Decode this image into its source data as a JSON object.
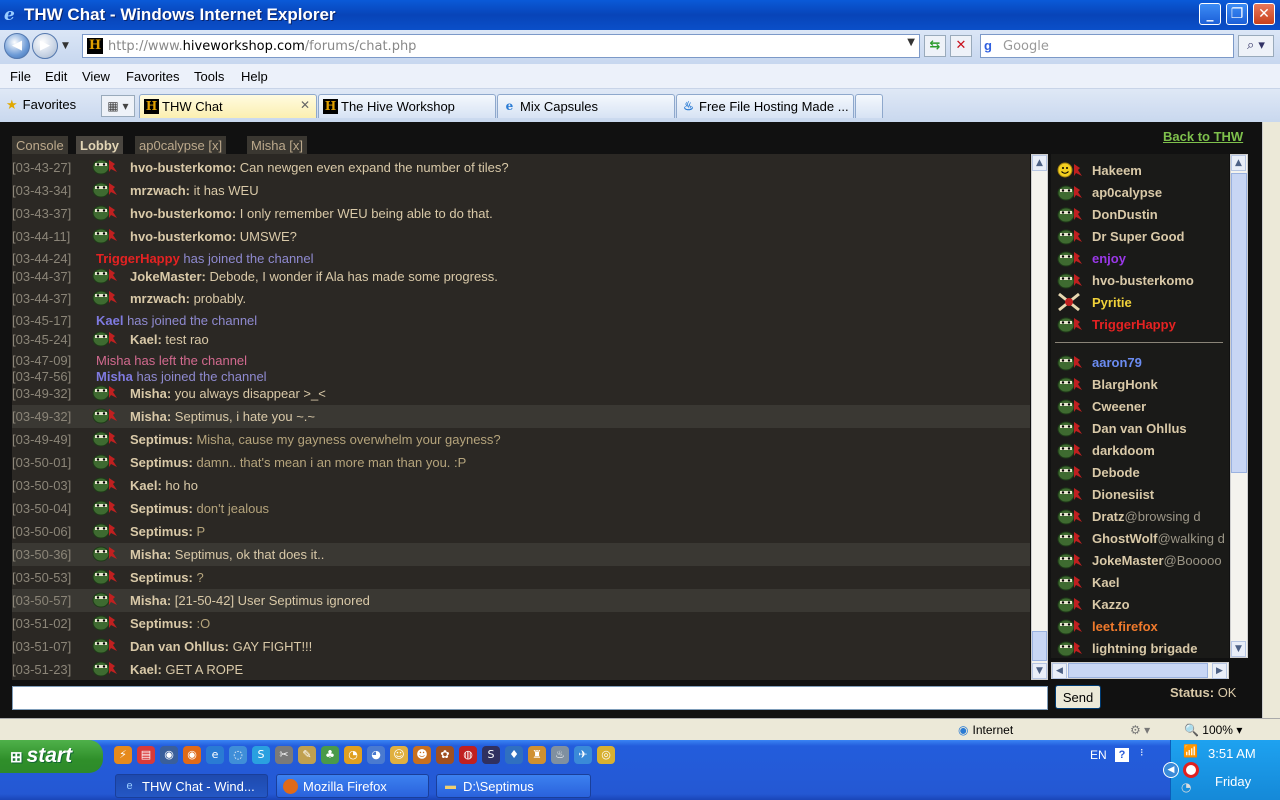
{
  "window": {
    "title": "THW Chat - Windows Internet Explorer",
    "url_prefix": "http://www.",
    "url_domain": "hiveworkshop.com",
    "url_path": "/forums/chat.php",
    "search_placeholder": "Google"
  },
  "menu": [
    "File",
    "Edit",
    "View",
    "Favorites",
    "Tools",
    "Help"
  ],
  "favorites_label": "Favorites",
  "browser_tabs": [
    {
      "label": "THW Chat",
      "active": true
    },
    {
      "label": "The Hive Workshop",
      "active": false
    },
    {
      "label": "Mix Capsules",
      "active": false
    },
    {
      "label": "Free File Hosting Made ...",
      "active": false
    }
  ],
  "chat": {
    "back_link": "Back to THW",
    "tabs": [
      "Console",
      "Lobby",
      "ap0calypse [x]",
      "Misha [x]"
    ],
    "active_tab": "Lobby",
    "messages": [
      {
        "time": "[03-43-27]",
        "nick": "hvo-busterkomo:",
        "text": "Can newgen even expand the number of tiles?",
        "type": "msg"
      },
      {
        "time": "[03-43-34]",
        "nick": "mrzwach:",
        "text": "it has WEU",
        "type": "msg"
      },
      {
        "time": "[03-43-37]",
        "nick": "hvo-busterkomo:",
        "text": "I only remember WEU being able to do that.",
        "type": "msg"
      },
      {
        "time": "[03-44-11]",
        "nick": "hvo-busterkomo:",
        "text": "UMSWE?",
        "type": "msg"
      },
      {
        "time": "[03-44-24]",
        "nick": "TriggerHappy",
        "text": "has joined the channel",
        "type": "join",
        "color": "#e52222"
      },
      {
        "time": "[03-44-37]",
        "nick": "JokeMaster:",
        "text": "Debode, I wonder if Ala has made some progress.",
        "type": "msg"
      },
      {
        "time": "[03-44-37]",
        "nick": "mrzwach:",
        "text": "probably.",
        "type": "msg"
      },
      {
        "time": "[03-45-17]",
        "nick": "Kael",
        "text": "has joined the channel",
        "type": "join",
        "color": "#7f7ae0"
      },
      {
        "time": "[03-45-24]",
        "nick": "Kael:",
        "text": "test rao",
        "type": "msg"
      },
      {
        "time": "[03-47-09]",
        "nick": "Misha has left the channel",
        "text": "",
        "type": "leave",
        "color": "#d26a8f"
      },
      {
        "time": "[03-47-56]",
        "nick": "Misha",
        "text": "has joined the channel",
        "type": "join",
        "color": "#7f7ae0"
      },
      {
        "time": "[03-49-32]",
        "nick": "Misha:",
        "text": "you always disappear >_<",
        "type": "msg"
      },
      {
        "time": "[03-49-32]",
        "nick": "Misha:",
        "text": "Septimus, i hate you ~.~",
        "type": "msg",
        "hl": true
      },
      {
        "time": "[03-49-49]",
        "nick": "Septimus:",
        "text": "Misha, cause my gayness overwhelm your gayness?",
        "type": "msg",
        "txtcolor": "#b5a47c"
      },
      {
        "time": "[03-50-01]",
        "nick": "Septimus:",
        "text": "damn.. that's mean i an more man than you. :P",
        "type": "msg",
        "txtcolor": "#b5a47c"
      },
      {
        "time": "[03-50-03]",
        "nick": "Kael:",
        "text": "ho ho",
        "type": "msg"
      },
      {
        "time": "[03-50-04]",
        "nick": "Septimus:",
        "text": "don't jealous",
        "type": "msg",
        "txtcolor": "#b5a47c"
      },
      {
        "time": "[03-50-06]",
        "nick": "Septimus:",
        "text": "P",
        "type": "msg",
        "txtcolor": "#b5a47c"
      },
      {
        "time": "[03-50-36]",
        "nick": "Misha:",
        "text": "Septimus, ok that does it..",
        "type": "msg",
        "hl": true
      },
      {
        "time": "[03-50-53]",
        "nick": "Septimus:",
        "text": "?",
        "type": "msg",
        "txtcolor": "#b5a47c"
      },
      {
        "time": "[03-50-57]",
        "nick": "Misha:",
        "text": "[21-50-42] User Septimus ignored",
        "type": "msg",
        "hl": true
      },
      {
        "time": "[03-51-02]",
        "nick": "Septimus:",
        "text": ":O",
        "type": "msg",
        "txtcolor": "#b5a47c"
      },
      {
        "time": "[03-51-07]",
        "nick": "Dan van Ohllus:",
        "text": "GAY FIGHT!!!",
        "type": "msg"
      },
      {
        "time": "[03-51-23]",
        "nick": "Kael:",
        "text": "GET A ROPE",
        "type": "msg"
      }
    ],
    "input_value": "",
    "send_label": "Send",
    "status_label": "Status:",
    "status_value": "OK"
  },
  "users": [
    {
      "name": "Hakeem",
      "color": "#d9c9a8",
      "icon": "smiley"
    },
    {
      "name": "ap0calypse",
      "color": "#d9c9a8"
    },
    {
      "name": "DonDustin",
      "color": "#d9c9a8"
    },
    {
      "name": "Dr Super Good",
      "color": "#d9c9a8"
    },
    {
      "name": "enjoy",
      "color": "#9a38e8"
    },
    {
      "name": "hvo-busterkomo",
      "color": "#d9c9a8"
    },
    {
      "name": "Pyritie",
      "color": "#f1d23a",
      "icon": "crossed-swords"
    },
    {
      "name": "TriggerHappy",
      "color": "#e52222"
    },
    {
      "name": "aaron79",
      "color": "#6b8cf2",
      "group2": true
    },
    {
      "name": "BlargHonk",
      "color": "#d9c9a8"
    },
    {
      "name": "Cweener",
      "color": "#d9c9a8"
    },
    {
      "name": "Dan van Ohllus",
      "color": "#d9c9a8"
    },
    {
      "name": "darkdoom",
      "color": "#d9c9a8"
    },
    {
      "name": "Debode",
      "color": "#d9c9a8"
    },
    {
      "name": "Dionesiist",
      "color": "#d9c9a8"
    },
    {
      "name": "Dratz",
      "status": "@browsing d",
      "color": "#d9c9a8"
    },
    {
      "name": "GhostWolf",
      "status": "@walking d",
      "color": "#d9c9a8"
    },
    {
      "name": "JokeMaster",
      "status": "@Booooo",
      "color": "#d9c9a8"
    },
    {
      "name": "Kael",
      "color": "#d9c9a8"
    },
    {
      "name": "Kazzo",
      "color": "#d9c9a8"
    },
    {
      "name": "leet.firefox",
      "color": "#f07a2c"
    },
    {
      "name": "lightning brigade",
      "color": "#d9c9a8"
    }
  ],
  "statusbar": {
    "zone": "Internet",
    "zoom": "100%"
  },
  "taskbar": {
    "start_label": "start",
    "buttons": [
      "THW Chat - Wind...",
      "Mozilla Firefox",
      "D:\\Septimus"
    ],
    "lang": "EN",
    "time": "3:51 AM",
    "day": "Friday"
  }
}
